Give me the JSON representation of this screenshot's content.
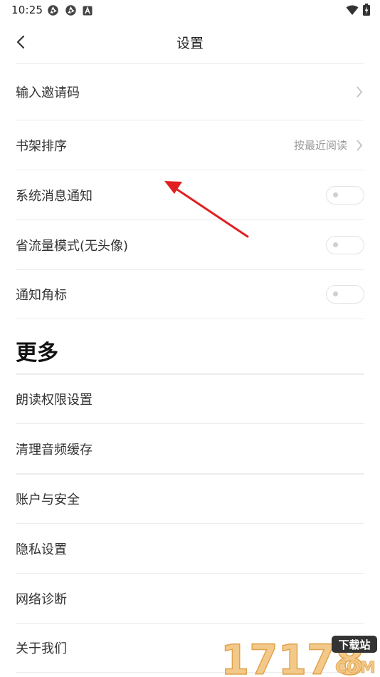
{
  "status_bar": {
    "time": "10:25",
    "icons_left": [
      "aperture-icon",
      "aperture-icon",
      "a-box-icon"
    ],
    "icons_right": [
      "wifi-icon",
      "battery-charging-icon"
    ]
  },
  "nav": {
    "title": "设置",
    "back_icon": "chevron-left-icon"
  },
  "settings": {
    "invite_code": {
      "label": "输入邀请码"
    },
    "shelf_sort": {
      "label": "书架排序",
      "value": "按最近阅读"
    },
    "system_notify": {
      "label": "系统消息通知",
      "on": false
    },
    "data_saver": {
      "label": "省流量模式(无头像)",
      "on": false
    },
    "badge": {
      "label": "通知角标",
      "on": false
    }
  },
  "more": {
    "title": "更多",
    "items": [
      {
        "label": "朗读权限设置"
      },
      {
        "label": "清理音频缓存"
      },
      {
        "label": "账户与安全"
      },
      {
        "label": "隐私设置"
      },
      {
        "label": "网络诊断"
      },
      {
        "label": "关于我们"
      }
    ]
  },
  "watermark": {
    "number": "17178",
    "badge": "下载站",
    "domain": "COM"
  },
  "colors": {
    "annotation_arrow": "#e02020",
    "watermark_fill": "#f3c98a",
    "watermark_stroke": "#e0a24a",
    "watermark_badge": "#333333"
  }
}
